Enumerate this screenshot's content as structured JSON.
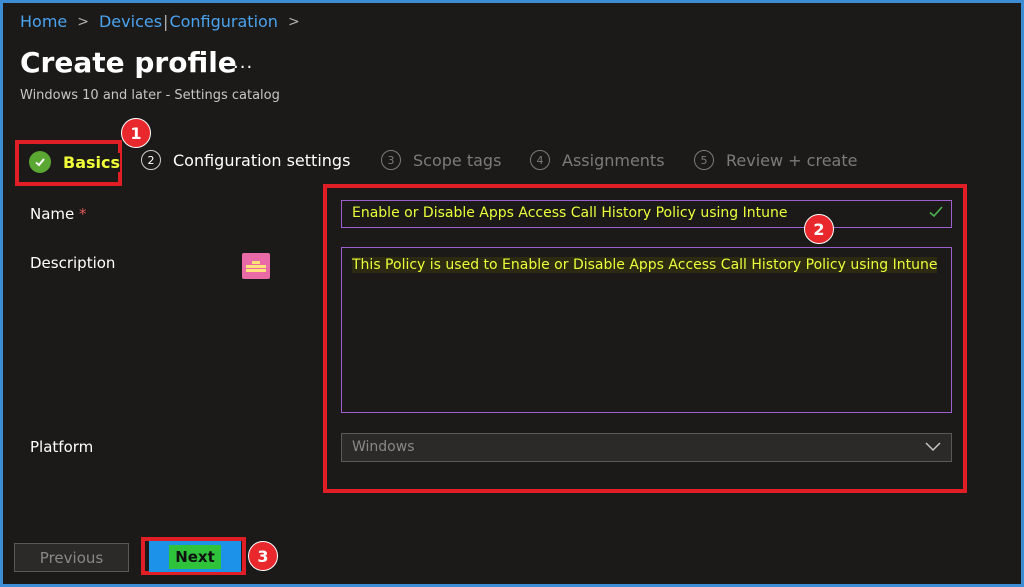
{
  "breadcrumb": {
    "home": "Home",
    "devices": "Devices",
    "pipe": "|",
    "configuration": "Configuration",
    "sep": ">"
  },
  "header": {
    "title": "Create profile",
    "more": "...",
    "subtitle": "Windows 10 and later - Settings catalog"
  },
  "steps": [
    {
      "number": "",
      "label": "Basics",
      "state": "complete"
    },
    {
      "number": "2",
      "label": "Configuration settings",
      "state": "upcoming"
    },
    {
      "number": "3",
      "label": "Scope tags",
      "state": "disabled"
    },
    {
      "number": "4",
      "label": "Assignments",
      "state": "disabled"
    },
    {
      "number": "5",
      "label": "Review + create",
      "state": "disabled"
    }
  ],
  "form": {
    "name_label": "Name",
    "required_marker": "*",
    "name_value": "Enable or Disable Apps Access Call History Policy using Intune",
    "description_label": "Description",
    "description_value": "This Policy is used to Enable or Disable Apps Access Call History Policy using Intune",
    "platform_label": "Platform",
    "platform_value": "Windows"
  },
  "annotations": [
    "1",
    "2",
    "3"
  ],
  "footer": {
    "previous_label": "Previous",
    "next_label": "Next"
  },
  "colors": {
    "accent": "#4aa3f0",
    "highlight_border": "#e01e26",
    "badge": "#e8282c",
    "success": "#5aa832",
    "highlight_text": "#eaff3a"
  },
  "icons": [
    "check-circle-icon",
    "checkmark-icon",
    "chevron-down-icon",
    "chevron-right-icon",
    "logo-icon"
  ]
}
